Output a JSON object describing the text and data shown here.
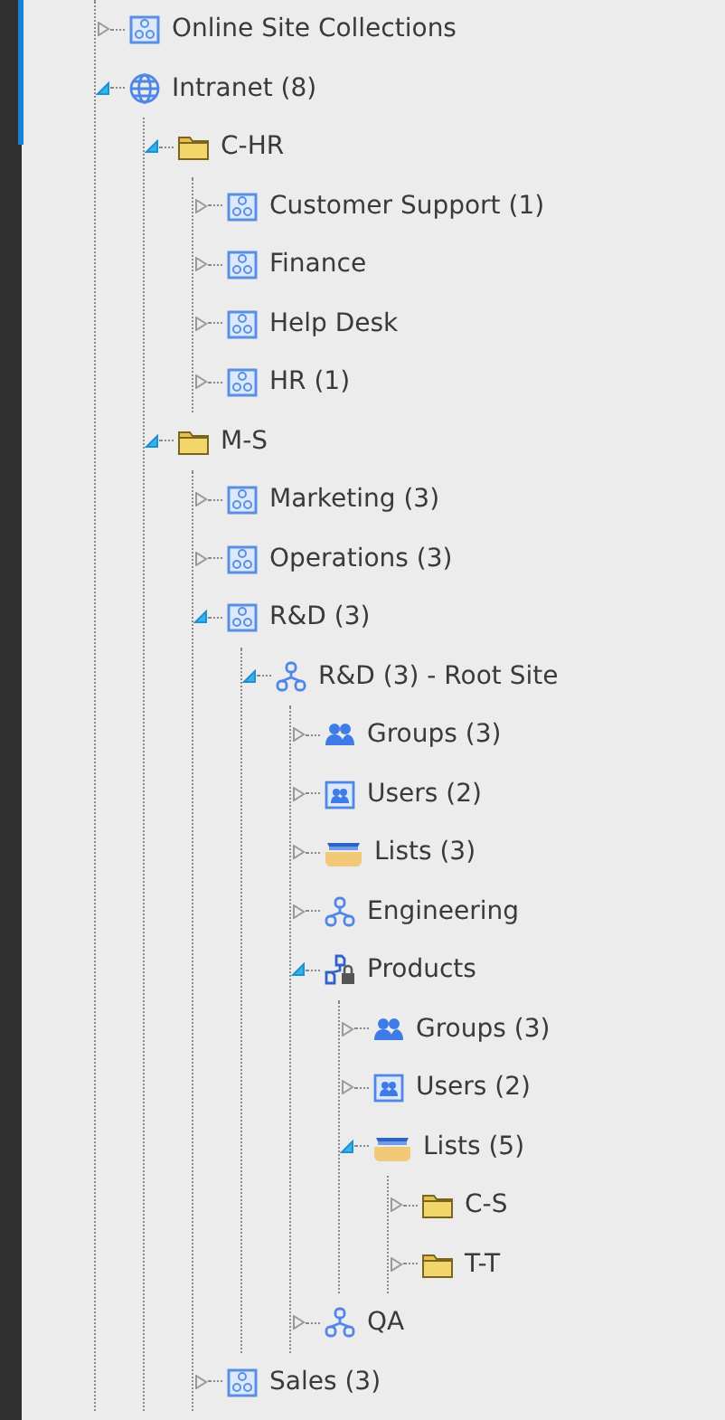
{
  "tree": [
    {
      "label": "Online Site Collections",
      "kind": "site-collection",
      "expanded": false
    },
    {
      "label": "Intranet (8)",
      "kind": "globe",
      "expanded": true,
      "children": [
        {
          "label": "C-HR",
          "kind": "folder",
          "expanded": true,
          "children": [
            {
              "label": "Customer Support (1)",
              "kind": "site-collection",
              "expanded": false
            },
            {
              "label": "Finance",
              "kind": "site-collection",
              "expanded": false
            },
            {
              "label": "Help Desk",
              "kind": "site-collection",
              "expanded": false
            },
            {
              "label": "HR (1)",
              "kind": "site-collection",
              "expanded": false
            }
          ]
        },
        {
          "label": "M-S",
          "kind": "folder",
          "expanded": true,
          "children": [
            {
              "label": "Marketing (3)",
              "kind": "site-collection",
              "expanded": false
            },
            {
              "label": "Operations (3)",
              "kind": "site-collection",
              "expanded": false
            },
            {
              "label": "R&D (3)",
              "kind": "site-collection",
              "expanded": true,
              "children": [
                {
                  "label": "R&D (3) - Root Site",
                  "kind": "site",
                  "expanded": true,
                  "children": [
                    {
                      "label": "Groups (3)",
                      "kind": "groups",
                      "expanded": false
                    },
                    {
                      "label": "Users (2)",
                      "kind": "users",
                      "expanded": false
                    },
                    {
                      "label": "Lists (3)",
                      "kind": "lists",
                      "expanded": false
                    },
                    {
                      "label": "Engineering",
                      "kind": "site",
                      "expanded": false
                    },
                    {
                      "label": "Products",
                      "kind": "site-locked",
                      "expanded": true,
                      "children": [
                        {
                          "label": "Groups (3)",
                          "kind": "groups",
                          "expanded": false
                        },
                        {
                          "label": "Users (2)",
                          "kind": "users",
                          "expanded": false
                        },
                        {
                          "label": "Lists (5)",
                          "kind": "lists",
                          "expanded": true,
                          "children": [
                            {
                              "label": "C-S",
                              "kind": "folder",
                              "expanded": false
                            },
                            {
                              "label": "T-T",
                              "kind": "folder",
                              "expanded": false
                            }
                          ]
                        }
                      ]
                    },
                    {
                      "label": "QA",
                      "kind": "site",
                      "expanded": false
                    }
                  ]
                }
              ]
            },
            {
              "label": "Sales (3)",
              "kind": "site-collection",
              "expanded": false
            }
          ]
        }
      ]
    }
  ]
}
